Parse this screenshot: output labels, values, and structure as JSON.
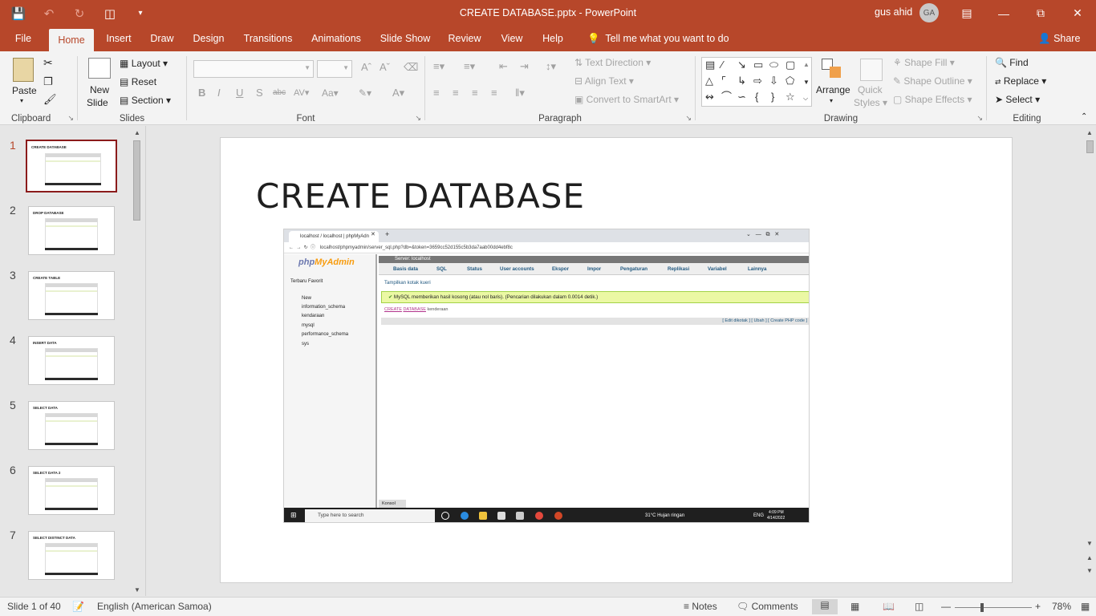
{
  "window": {
    "doc_title": "CREATE DATABASE.pptx  -  PowerPoint",
    "user_name": "gus ahid",
    "user_initials": "GA"
  },
  "menu": {
    "tabs": [
      "File",
      "Home",
      "Insert",
      "Draw",
      "Design",
      "Transitions",
      "Animations",
      "Slide Show",
      "Review",
      "View",
      "Help"
    ],
    "tell_me": "Tell me what you want to do",
    "share": "Share"
  },
  "ribbon": {
    "clipboard": {
      "paste": "Paste",
      "label": "Clipboard"
    },
    "slides": {
      "new_slide_1": "New",
      "new_slide_2": "Slide",
      "layout": "Layout",
      "reset": "Reset",
      "section": "Section",
      "label": "Slides"
    },
    "font": {
      "label": "Font"
    },
    "paragraph": {
      "text_direction": "Text Direction",
      "align_text": "Align Text",
      "convert_smartart": "Convert to SmartArt",
      "label": "Paragraph"
    },
    "drawing": {
      "arrange": "Arrange",
      "quick_1": "Quick",
      "quick_2": "Styles",
      "shape_fill": "Shape Fill",
      "shape_outline": "Shape Outline",
      "shape_effects": "Shape Effects",
      "label": "Drawing"
    },
    "editing": {
      "find": "Find",
      "replace": "Replace",
      "select": "Select",
      "label": "Editing"
    }
  },
  "thumbnails": [
    {
      "num": "1",
      "title": "CREATE DATABASE"
    },
    {
      "num": "2",
      "title": "DROP DATABASE"
    },
    {
      "num": "3",
      "title": "CREATE TABLE"
    },
    {
      "num": "4",
      "title": "INSERT DATA"
    },
    {
      "num": "5",
      "title": "SELECT DATA"
    },
    {
      "num": "6",
      "title": "SELECT DATA 2"
    },
    {
      "num": "7",
      "title": "SELECT DISTINCT DATA"
    }
  ],
  "slide": {
    "title": "CREATE DATABASE",
    "screenshot": {
      "tab_title": "localhost / localhost | phpMyAdn",
      "url": "localhost/phpmyadmin/server_sql.php?db=&token=3659cc52d155c5b3da7aab00dd4ebf8c",
      "logo_php": "php",
      "logo_myadmin": "MyAdmin",
      "side_tabs": "Terbaru   Favorit",
      "db_list": [
        "New",
        "information_schema",
        "kendaraan",
        "mysql",
        "performance_schema",
        "sys"
      ],
      "crumb": "Server: localhost",
      "nav": [
        "Basis data",
        "SQL",
        "Status",
        "User accounts",
        "Ekspor",
        "Impor",
        "Pengaturan",
        "Replikasi",
        "Variabel",
        "Lainnya"
      ],
      "show_query": "Tampilkan kotak kueri",
      "success_msg": "MySQL memberikan hasil kosong (atau nol baris). (Pencarian dilakukan dalam 0.0014 detik.)",
      "sql_kw1": "CREATE",
      "sql_kw2": "DATABASE",
      "sql_name": "kenderaan",
      "links": "[ Edit dikotak ] [ Ubah ] [ Create PHP code ]",
      "console": "Konsol",
      "taskbar_search": "Type here to search",
      "weather": "31°C  Hujan ringan",
      "lang": "ENG",
      "time": "4:09 PM",
      "date": "4/14/2022"
    }
  },
  "status": {
    "slide_info": "Slide 1 of 40",
    "language": "English (American Samoa)",
    "notes": "Notes",
    "comments": "Comments",
    "zoom": "78%"
  }
}
